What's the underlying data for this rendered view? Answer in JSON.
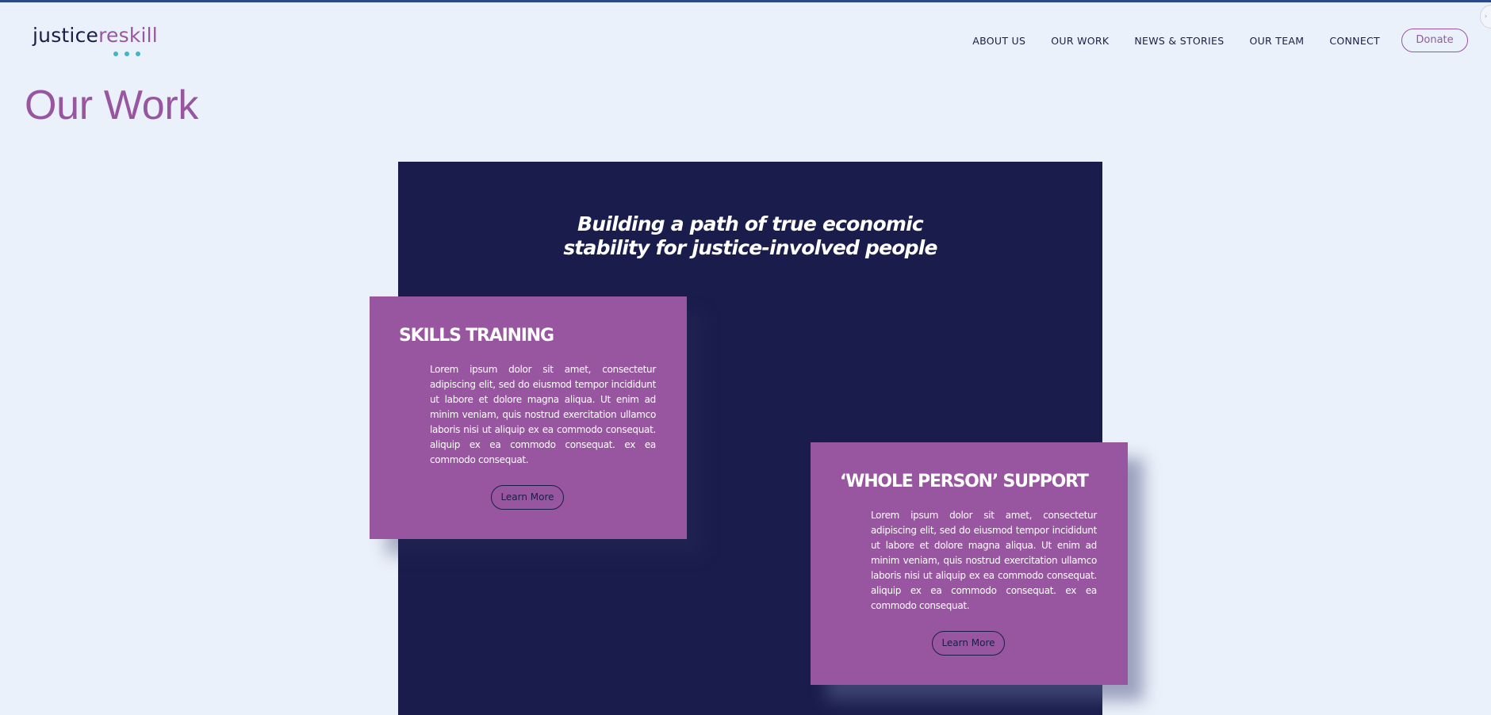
{
  "brand": {
    "logo_part1": "justice",
    "logo_part2": "reskill",
    "colors": {
      "primary_purple": "#97569f",
      "navy": "#1a1d4b",
      "teal_dot": "#3fb6c9",
      "page_bg": "#ebf1fa"
    }
  },
  "nav": {
    "items": [
      "ABOUT US",
      "OUR WORK",
      "NEWS & STORIES",
      "OUR TEAM",
      "CONNECT"
    ],
    "donate": "Donate"
  },
  "page": {
    "title": "Our Work"
  },
  "hero": {
    "heading_line1": "Building a path of true economic",
    "heading_line2": "stability for justice-involved people"
  },
  "cards": [
    {
      "title": "SKILLS TRAINING",
      "body": "Lorem ipsum dolor sit amet, consectetur adipiscing elit, sed do eiusmod tempor incididunt ut labore et dolore magna aliqua. Ut enim ad minim veniam, quis nostrud exercitation ullamco laboris nisi ut aliquip ex ea commodo consequat. aliquip ex ea commodo consequat. ex ea commodo consequat.",
      "button": "Learn More"
    },
    {
      "title": "‘WHOLE PERSON’ SUPPORT",
      "body": "Lorem ipsum dolor sit amet, consectetur adipiscing elit, sed do eiusmod tempor incididunt ut labore et dolore magna aliqua. Ut enim ad minim veniam, quis nostrud exercitation ullamco laboris nisi ut aliquip ex ea commodo consequat. aliquip ex ea commodo consequat. ex ea commodo consequat.",
      "button": "Learn More"
    }
  ]
}
